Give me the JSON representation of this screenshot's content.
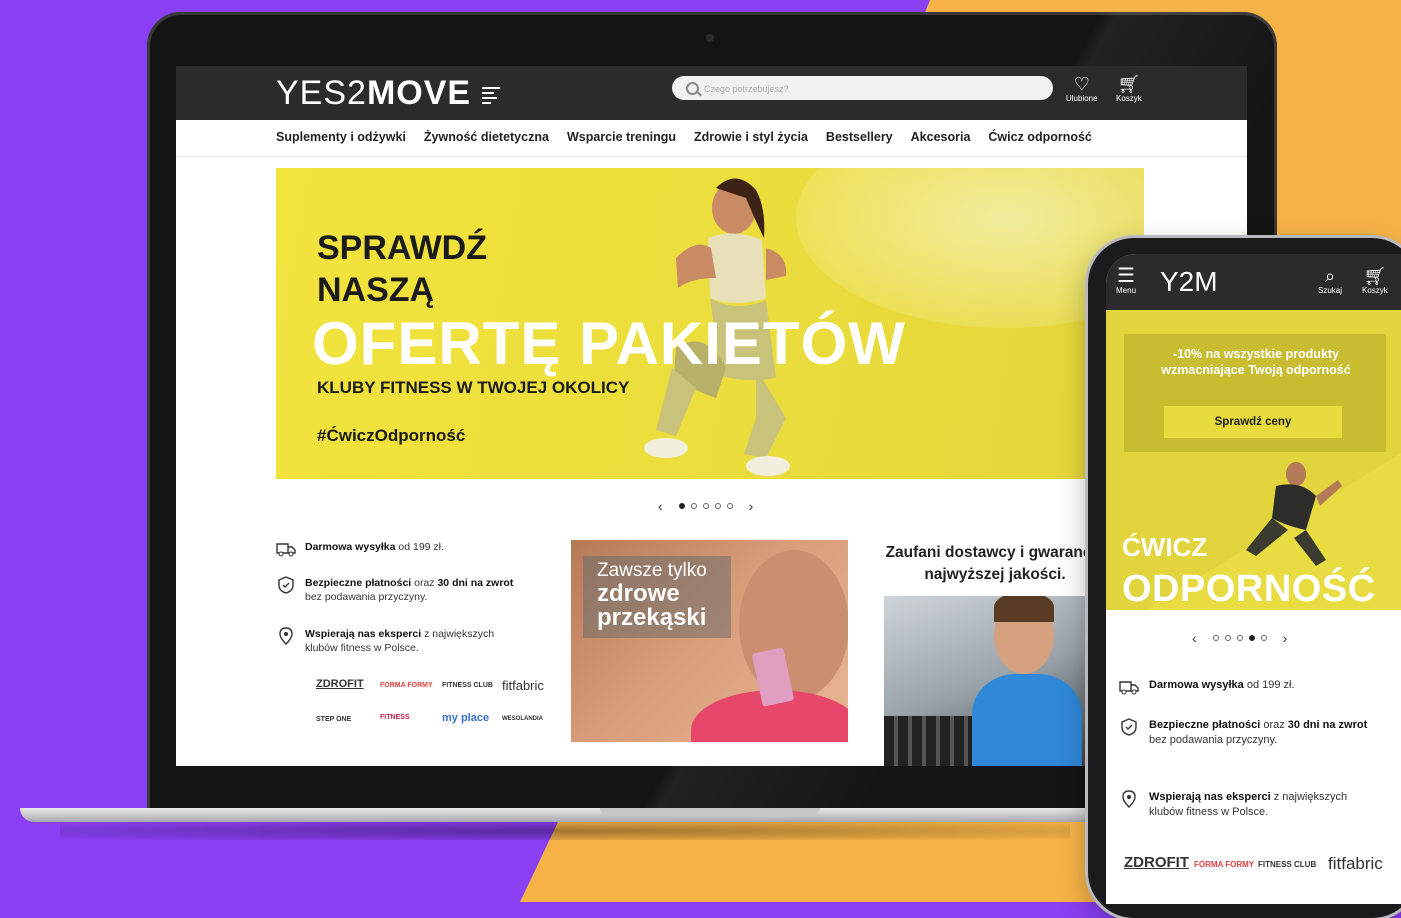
{
  "desktop": {
    "logo_thin": "YES2",
    "logo_bold": "MOVE",
    "search": {
      "placeholder": "Czego potrzebujesz?"
    },
    "header_buttons": {
      "favorites": "Ulubione",
      "cart": "Koszyk"
    },
    "nav": [
      "Suplementy i odżywki",
      "Żywność dietetyczna",
      "Wsparcie treningu",
      "Zdrowie i styl życia",
      "Bestsellery",
      "Akcesoria",
      "Ćwicz odporność"
    ],
    "hero": {
      "line1": "SPRAWDŹ",
      "line2": "NASZĄ",
      "headline": "OFERTĘ PAKIETÓW",
      "subtitle": "KLUBY FITNESS W TWOJEJ OKOLICY",
      "hashtag": "#ĆwiczOdporność"
    },
    "carousel": {
      "prev": "‹",
      "next": "›",
      "slides": 5,
      "active": 1
    },
    "features": [
      {
        "icon": "truck-icon",
        "bold": "Darmowa wysyłka",
        "rest": " od 199 zł.",
        "line2": ""
      },
      {
        "icon": "shield-icon",
        "bold": "Bezpieczne płatności",
        "mid": " oraz ",
        "bold2": "30 dni na zwrot",
        "line2": "bez podawania przyczyny."
      },
      {
        "icon": "location-pin-icon",
        "bold": "Wspierają nas eksperci",
        "rest": " z największych",
        "line2": "klubów fitness w Polsce."
      }
    ],
    "brands_row1": [
      "ZDROFIT",
      "FORMA FORMY",
      "FITNESS CLUB",
      "fitfabric"
    ],
    "brands_row2": [
      "STEP ONE",
      "FITNESS",
      "my place",
      "WESOLANDIA"
    ],
    "snack_card": {
      "t1": "Zawsze tylko",
      "t2": "zdrowe",
      "t3": "przekąski"
    },
    "trust_title": "Zaufani dostawcy i gwarancja najwyższej jakości."
  },
  "mobile": {
    "menu_label": "Menu",
    "logo": "Y2M",
    "search_label": "Szukaj",
    "cart_label": "Koszyk",
    "promo_text": "-10% na wszystkie produkty wzmacniające Twoją odporność",
    "promo_button": "Sprawdź ceny",
    "hero_l1": "ĆWICZ",
    "hero_l2": "ODPORNOŚĆ",
    "carousel": {
      "prev": "‹",
      "next": "›",
      "slides": 5,
      "active": 4
    },
    "features": [
      {
        "bold": "Darmowa wysyłka",
        "rest": " od 199 zł.",
        "line2": ""
      },
      {
        "bold": "Bezpieczne płatności",
        "mid": " oraz ",
        "bold2": "30 dni na zwrot",
        "line2": "bez podawania przyczyny."
      },
      {
        "bold": "Wspierają nas eksperci",
        "rest": " z największych",
        "line2": "klubów fitness w Polsce."
      }
    ],
    "brands": [
      "ZDROFIT",
      "FORMA FORMY",
      "FITNESS CLUB",
      "fitfabric"
    ]
  },
  "colors": {
    "purple": "#8a3ff2",
    "orange": "#f7b347",
    "yellow": "#f2e33d",
    "header": "#2b2b2d"
  }
}
